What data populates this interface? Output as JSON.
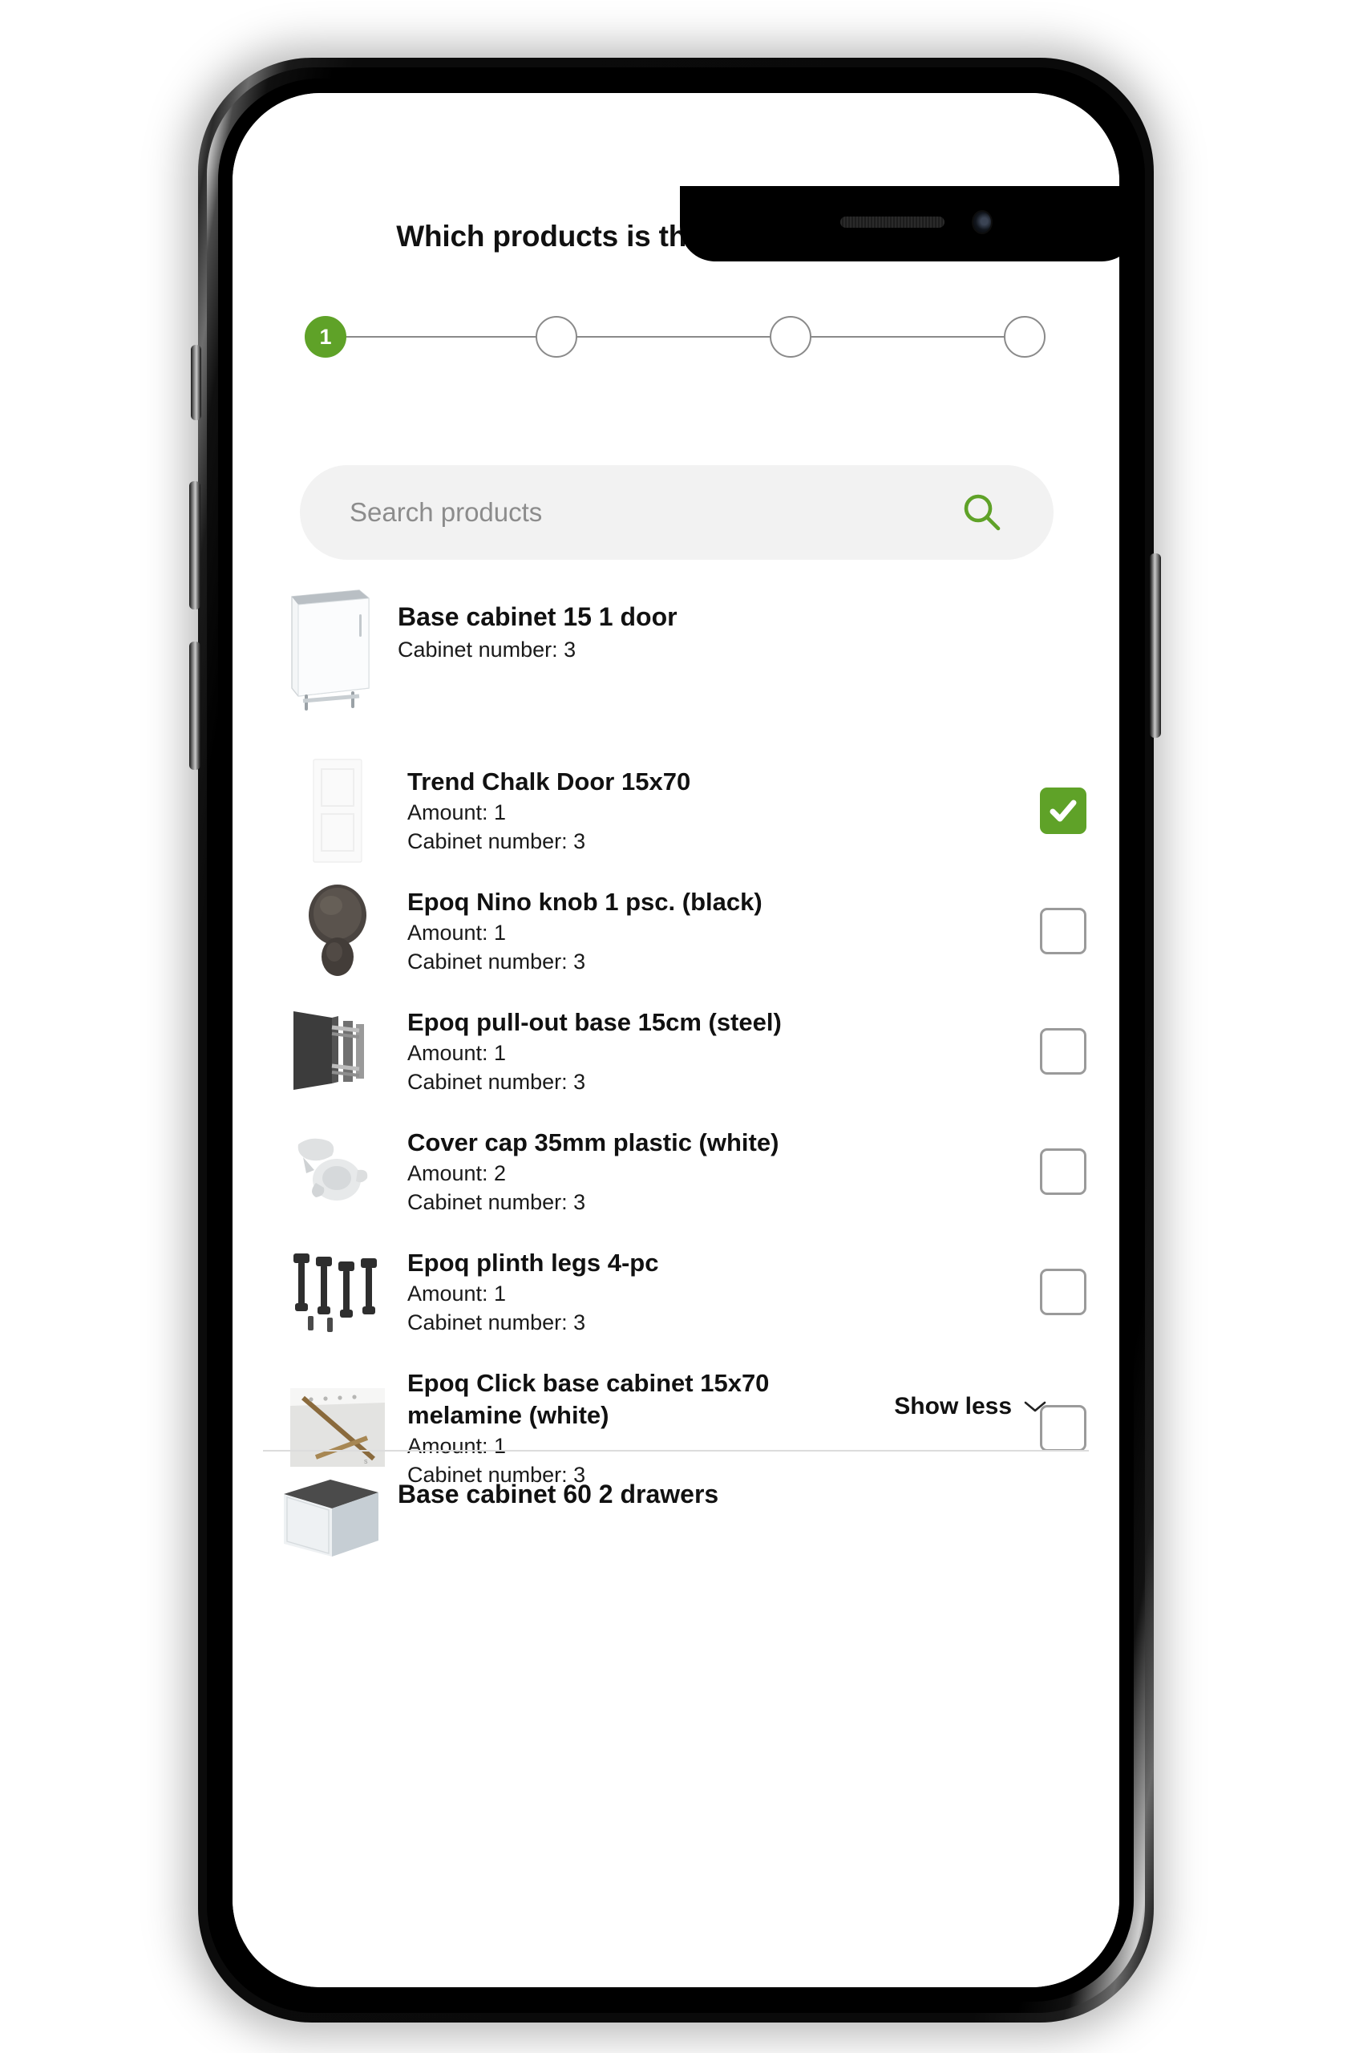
{
  "header": {
    "title": "Which products is the complaint about?"
  },
  "stepper": {
    "steps": [
      {
        "label": "1",
        "state": "active"
      },
      {
        "label": "",
        "state": "pending"
      },
      {
        "label": "",
        "state": "pending"
      },
      {
        "label": "",
        "state": "pending"
      }
    ],
    "active_color": "#5fa228",
    "line_color": "#8a8a8a"
  },
  "search": {
    "placeholder": "Search products",
    "value": "",
    "icon": "search-icon",
    "icon_color": "#5fa228",
    "background": "#f2f2f2"
  },
  "labels": {
    "amount_prefix": "Amount: ",
    "cabinet_prefix": "Cabinet number: ",
    "show_less": "Show less"
  },
  "groups": [
    {
      "title": "Base cabinet 15 1 door",
      "subtitle": "Cabinet number: 3",
      "thumb": "base-cabinet-15-thumb",
      "items": [
        {
          "title": "Trend Chalk Door 15x70",
          "amount": "Amount: 1",
          "cabinet": "Cabinet number: 3",
          "thumb": "door-thumb",
          "checked": true
        },
        {
          "title": "Epoq Nino knob 1 psc. (black)",
          "amount": "Amount: 1",
          "cabinet": "Cabinet number: 3",
          "thumb": "knob-thumb",
          "checked": false
        },
        {
          "title": "Epoq pull-out base 15cm (steel)",
          "amount": "Amount: 1",
          "cabinet": "Cabinet number: 3",
          "thumb": "pullout-thumb",
          "checked": false
        },
        {
          "title": "Cover cap 35mm plastic (white)",
          "amount": "Amount: 2",
          "cabinet": "Cabinet number: 3",
          "thumb": "covercap-thumb",
          "checked": false
        },
        {
          "title": "Epoq plinth legs 4-pc",
          "amount": "Amount: 1",
          "cabinet": "Cabinet number: 3",
          "thumb": "legs-thumb",
          "checked": false
        },
        {
          "title": "Epoq Click base cabinet 15x70 melamine (white)",
          "amount": "Amount: 1",
          "cabinet": "Cabinet number: 3",
          "thumb": "clickbase-thumb",
          "checked": false
        }
      ]
    },
    {
      "title": "Base cabinet 60 2 drawers",
      "subtitle": "",
      "thumb": "base-cabinet-60-thumb",
      "items": []
    }
  ],
  "colors": {
    "accent_green": "#5fa228",
    "text_primary": "#111111",
    "text_muted": "#8c8c8c",
    "divider": "#dcdcdc"
  }
}
